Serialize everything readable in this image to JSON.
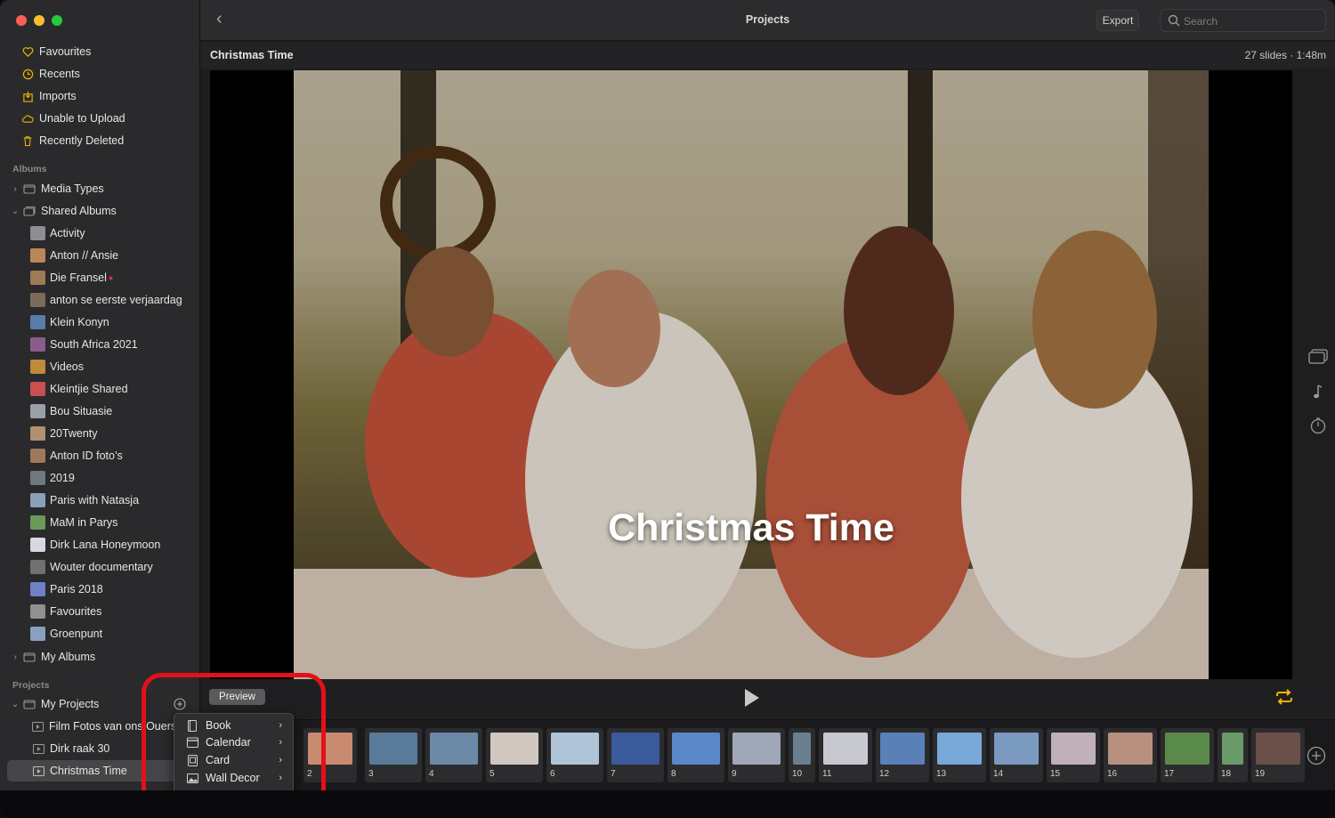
{
  "window": {
    "title": "Projects",
    "export_label": "Export",
    "search_placeholder": "Search"
  },
  "sidebar": {
    "library": [
      {
        "label": "Favourites",
        "icon": "heart-icon"
      },
      {
        "label": "Recents",
        "icon": "clock-icon"
      },
      {
        "label": "Imports",
        "icon": "import-icon"
      },
      {
        "label": "Unable to Upload",
        "icon": "cloud-icon"
      },
      {
        "label": "Recently Deleted",
        "icon": "trash-icon"
      }
    ],
    "albums_header": "Albums",
    "media_types": "Media Types",
    "shared_albums": "Shared Albums",
    "shared": [
      {
        "label": "Activity",
        "color": "#8e8e92"
      },
      {
        "label": "Anton // Ansie",
        "color": "#b8885a"
      },
      {
        "label": "Die Fransel",
        "color": "#a07a55"
      },
      {
        "label": "anton se eerste verjaardag",
        "color": "#7a6b5d"
      },
      {
        "label": "Klein Konyn",
        "color": "#5a7ca8"
      },
      {
        "label": "South Africa 2021",
        "color": "#8a5c8c"
      },
      {
        "label": "Videos",
        "color": "#c08a3a"
      },
      {
        "label": "Kleintjie Shared",
        "color": "#c85050"
      },
      {
        "label": "Bou Situasie",
        "color": "#9aa0a8"
      },
      {
        "label": "20Twenty",
        "color": "#b09070"
      },
      {
        "label": "Anton ID foto’s",
        "color": "#a0785a"
      },
      {
        "label": "2019",
        "color": "#707880"
      },
      {
        "label": "Paris with Natasja",
        "color": "#8ca0b8"
      },
      {
        "label": "MaM in Parys",
        "color": "#6a9a5a"
      },
      {
        "label": "Dirk Lana Honeymoon",
        "color": "#d8d8e0"
      },
      {
        "label": "Wouter documentary",
        "color": "#707070"
      },
      {
        "label": "Paris 2018",
        "color": "#7080c8"
      },
      {
        "label": "Favourites",
        "color": "#909090"
      },
      {
        "label": "Groenpunt",
        "color": "#8aa0c0"
      }
    ],
    "my_albums": "My Albums",
    "projects_header": "Projects",
    "my_projects": "My Projects",
    "projects": [
      {
        "label": "Film Fotos van ons Ouers & Grouda"
      },
      {
        "label": "Dirk raak 30"
      },
      {
        "label": "Christmas Time"
      }
    ]
  },
  "project": {
    "name": "Christmas Time",
    "meta": "27 slides · 1:48m",
    "slide_title": "Christmas Time"
  },
  "controls": {
    "preview_label": "Preview"
  },
  "menu": [
    {
      "label": "Book"
    },
    {
      "label": "Calendar"
    },
    {
      "label": "Card"
    },
    {
      "label": "Wall Decor"
    }
  ],
  "slides": [
    {
      "num": "2",
      "color": "#c88a70"
    },
    {
      "num": "3",
      "color": "#5a7a9a"
    },
    {
      "num": "4",
      "color": "#6a8aa8"
    },
    {
      "num": "5",
      "color": "#d0c8c0"
    },
    {
      "num": "6",
      "color": "#b0c4d8"
    },
    {
      "num": "7",
      "color": "#3a5a9a"
    },
    {
      "num": "8",
      "color": "#5a88c8"
    },
    {
      "num": "9",
      "color": "#a0a8b8"
    },
    {
      "num": "10",
      "color": "#6a8090"
    },
    {
      "num": "11",
      "color": "#c8c8d0"
    },
    {
      "num": "12",
      "color": "#5a80b8"
    },
    {
      "num": "13",
      "color": "#78a8d8"
    },
    {
      "num": "14",
      "color": "#7a9ac0"
    },
    {
      "num": "15",
      "color": "#c0b0b8"
    },
    {
      "num": "16",
      "color": "#b89080"
    },
    {
      "num": "17",
      "color": "#5a8a4a"
    },
    {
      "num": "18",
      "color": "#6a9a6a"
    },
    {
      "num": "19",
      "color": "#6a5048"
    }
  ]
}
